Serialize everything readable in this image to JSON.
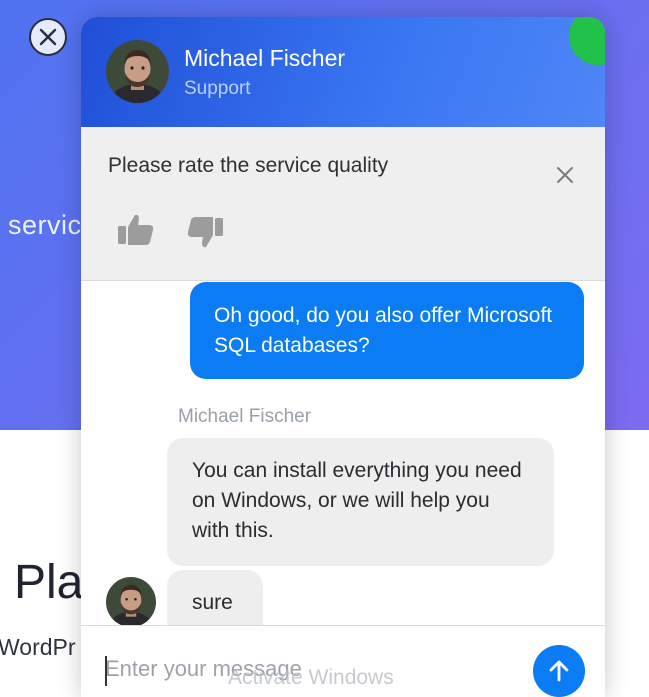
{
  "background": {
    "service_fragment": "servic",
    "heading_fragment": "Pla",
    "subheading_fragment": "WordPr"
  },
  "header": {
    "agent_name": "Michael Fischer",
    "agent_role": "Support"
  },
  "rating": {
    "title": "Please rate the service quality"
  },
  "messages": [
    {
      "from": "user",
      "text": "Oh good, do you also offer Microsoft SQL databases?"
    },
    {
      "from": "agent",
      "sender": "Michael Fischer",
      "text": "You can install everything you need on Windows, or we will help you with this."
    },
    {
      "from": "agent",
      "text": "sure"
    }
  ],
  "composer": {
    "placeholder": "Enter your message"
  },
  "watermark": "Activate Windows",
  "colors": {
    "accent": "#0b7cf3",
    "header_start": "#1f4fd6",
    "header_end": "#4f86f7",
    "online": "#21c24a"
  },
  "icons": {
    "close": "close-icon",
    "thumb_up": "thumbs-up-icon",
    "thumb_down": "thumbs-down-icon",
    "send": "arrow-up-icon"
  }
}
